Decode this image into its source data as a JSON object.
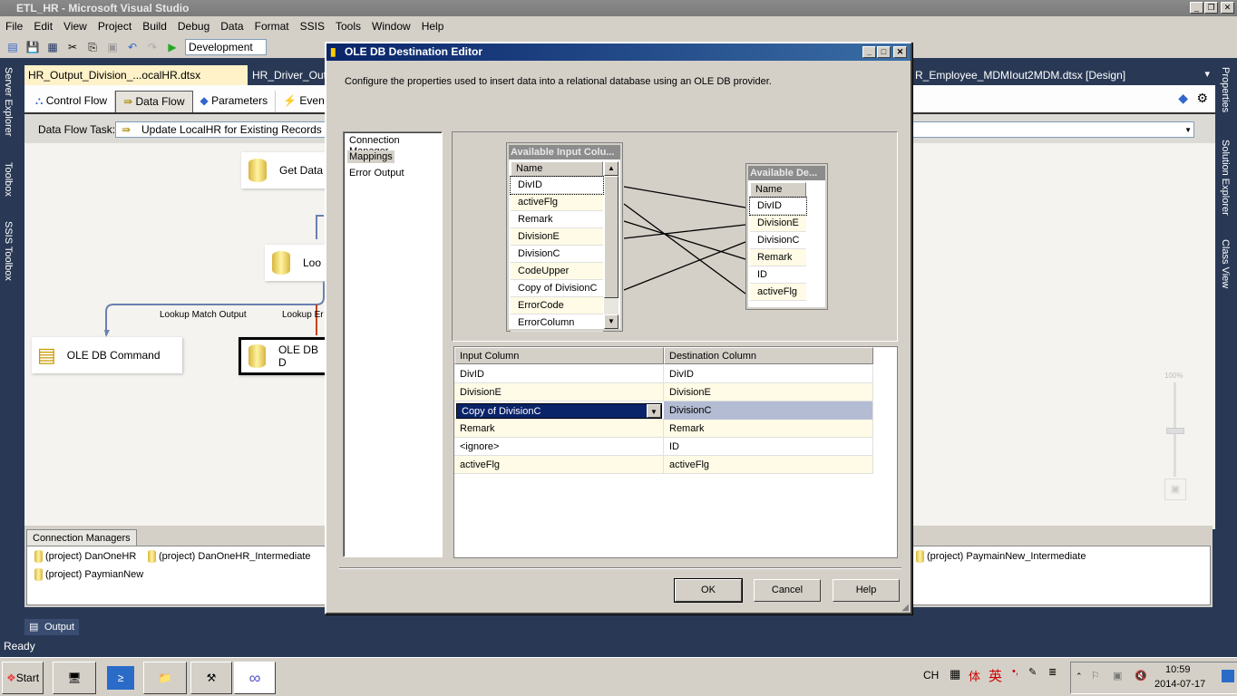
{
  "window": {
    "title": "ETL_HR - Microsoft Visual Studio"
  },
  "menu": [
    "File",
    "Edit",
    "View",
    "Project",
    "Build",
    "Debug",
    "Data",
    "Format",
    "SSIS",
    "Tools",
    "Window",
    "Help"
  ],
  "toolbar": {
    "configuration": "Development"
  },
  "left_rail": [
    "Server Explorer",
    "Toolbox",
    "SSIS Toolbox"
  ],
  "right_rail": [
    "Properties",
    "Solution Explorer",
    "Class View"
  ],
  "doc_tabs": [
    {
      "label": "HR_Output_Division_...ocalHR.dtsx [Design]*",
      "active": true
    },
    {
      "label": "HR_Driver_Outp"
    },
    {
      "label": "R_Employee_MDMIout2MDM.dtsx [Design]"
    }
  ],
  "designer_tabs": [
    "Control Flow",
    "Data Flow",
    "Parameters",
    "Event H"
  ],
  "data_flow_task": {
    "label": "Data Flow Task:",
    "value": "Update LocalHR for Existing Records"
  },
  "canvas": {
    "nodes": [
      "Get Data",
      "Loo",
      "OLE DB Command",
      "OLE DB D"
    ],
    "paths": [
      "Lookup Match Output",
      "Lookup Er"
    ],
    "zoom": "100%"
  },
  "connection_managers": {
    "tab": "Connection Managers",
    "items": [
      "(project) DanOneHR",
      "(project) DanOneHR_Intermediate",
      "(project) PaymianNew",
      "(project) PaymainNew_Intermediate"
    ]
  },
  "output_tab": "Output",
  "status": "Ready",
  "taskbar": {
    "start": "Start",
    "lang": "CH",
    "ime": "英",
    "time": "10:59",
    "date": "2014-07-17"
  },
  "dialog": {
    "title": "OLE DB Destination Editor",
    "description": "Configure the properties used to insert data into a relational database using an OLE DB provider.",
    "pages": [
      "Connection Manager",
      "Mappings",
      "Error Output"
    ],
    "selected_page": "Mappings",
    "input_box": {
      "title": "Available Input Colu...",
      "header": "Name",
      "columns": [
        "DivID",
        "activeFlg",
        "Remark",
        "DivisionE",
        "DivisionC",
        "CodeUpper",
        "Copy of DivisionC",
        "ErrorCode",
        "ErrorColumn"
      ]
    },
    "dest_box": {
      "title": "Available De...",
      "header": "Name",
      "columns": [
        "DivID",
        "DivisionE",
        "DivisionC",
        "Remark",
        "ID",
        "activeFlg"
      ]
    },
    "grid": {
      "headers": [
        "Input Column",
        "Destination Column"
      ],
      "rows": [
        [
          "DivID",
          "DivID"
        ],
        [
          "DivisionE",
          "DivisionE"
        ],
        [
          "Copy of DivisionC",
          "DivisionC"
        ],
        [
          "Remark",
          "Remark"
        ],
        [
          "<ignore>",
          "ID"
        ],
        [
          "activeFlg",
          "activeFlg"
        ]
      ],
      "selected_row": 2
    },
    "buttons": {
      "ok": "OK",
      "cancel": "Cancel",
      "help": "Help"
    }
  }
}
